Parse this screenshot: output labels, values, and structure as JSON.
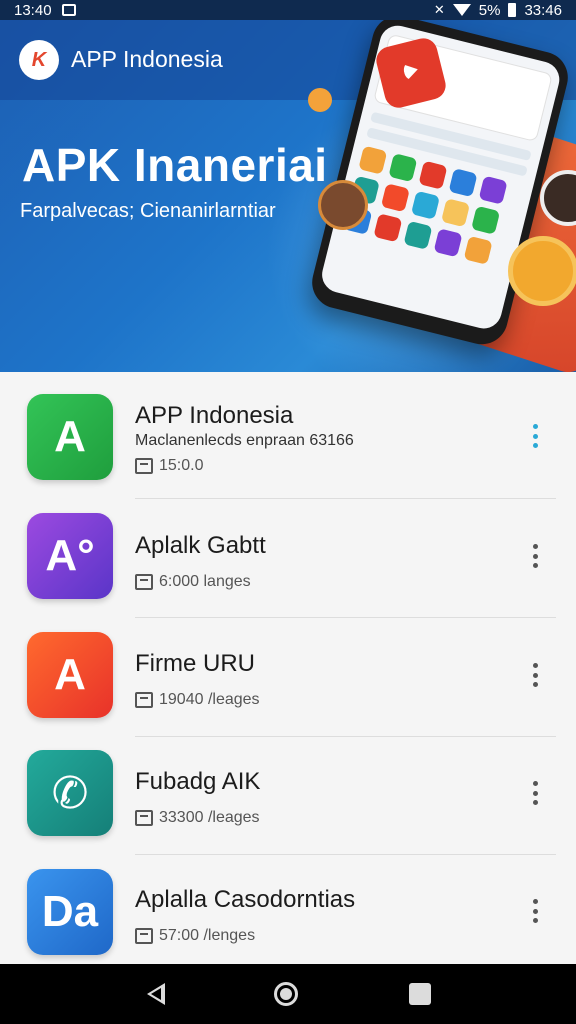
{
  "status_bar": {
    "time": "13:40",
    "battery_text": "5%",
    "right_text": "33:46"
  },
  "header": {
    "app_name": "APP Indonesia",
    "hero_title": "APK Inaneriai",
    "hero_subtitle": "Farpalvecas; Cienanirlarntiar"
  },
  "apps": [
    {
      "title": "APP Indonesia",
      "description": "Maclanenlecds enpraan 63166",
      "meta": "15:0.0",
      "icon_letter": "A",
      "icon_color": "#2bb34b",
      "icon_name": "green-a-app-icon",
      "more_color": "teal"
    },
    {
      "title": "Aplalk Gabtt",
      "description": "",
      "meta": "6:000  langes",
      "icon_letter": "A°",
      "icon_color": "#7b3fd6",
      "icon_name": "purple-ao-app-icon",
      "more_color": "gray"
    },
    {
      "title": "Firme URU",
      "description": "",
      "meta": "19040 /leages",
      "icon_letter": "A",
      "icon_color": "#f24a2a",
      "icon_name": "orange-star-app-icon",
      "more_color": "gray"
    },
    {
      "title": "Fubadg AIK",
      "description": "",
      "meta": "33300 /leages",
      "icon_letter": "✆",
      "icon_color": "#1e9e93",
      "icon_name": "teal-phone-app-icon",
      "more_color": "gray"
    },
    {
      "title": "Aplalla Casodorntias",
      "description": "",
      "meta": "57:00 /lenges",
      "icon_letter": "Da",
      "icon_color": "#2b7fdb",
      "icon_name": "blue-da-app-icon",
      "more_color": "gray"
    }
  ],
  "colors": {
    "hero_blue": "#1e74c9",
    "more_teal": "#2aa9d6"
  }
}
